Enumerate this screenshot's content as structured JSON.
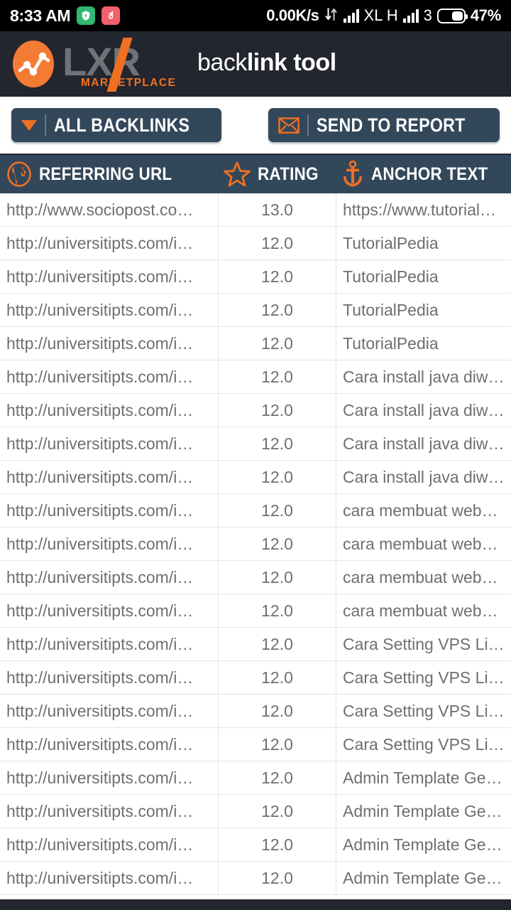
{
  "status_bar": {
    "clock": "8:33 AM",
    "app_icons": [
      {
        "name": "security-shield-icon",
        "color": "#2eb872"
      },
      {
        "name": "music-note-icon",
        "color": "#f4606c"
      }
    ],
    "network_speed": "0.00K/s",
    "data-transfer-icon": "up-down-arrows-icon",
    "network_type": "XL H",
    "sim_number": "3",
    "battery_percent": "47%"
  },
  "app_header": {
    "brand_letters": "LXR",
    "brand_sub": "MARKETPLACE",
    "product_thin": "back",
    "product_bold": "link tool",
    "logo_icon": "lxr-chart-logo-icon",
    "background": "#23262e"
  },
  "toolbar": {
    "filter_button": {
      "label": "ALL BACKLINKS",
      "icon": "chevron-down-icon"
    },
    "report_button": {
      "label": "SEND TO REPORT",
      "icon": "envelope-icon"
    },
    "accent_color": "#f07022",
    "button_color": "#33475a"
  },
  "table": {
    "columns": [
      {
        "label": "REFERRING URL",
        "icon": "globe-icon"
      },
      {
        "label": "RATING",
        "icon": "star-icon"
      },
      {
        "label": "ANCHOR TEXT",
        "icon": "anchor-icon"
      }
    ],
    "rows": [
      {
        "url": "http://www.sociopost.co…",
        "rating": "13.0",
        "anchor": "https://www.tutorial…"
      },
      {
        "url": "http://universitipts.com/i…",
        "rating": "12.0",
        "anchor": "TutorialPedia"
      },
      {
        "url": "http://universitipts.com/i…",
        "rating": "12.0",
        "anchor": "TutorialPedia"
      },
      {
        "url": "http://universitipts.com/i…",
        "rating": "12.0",
        "anchor": "TutorialPedia"
      },
      {
        "url": "http://universitipts.com/i…",
        "rating": "12.0",
        "anchor": "TutorialPedia"
      },
      {
        "url": "http://universitipts.com/i…",
        "rating": "12.0",
        "anchor": "Cara install java diw…"
      },
      {
        "url": "http://universitipts.com/i…",
        "rating": "12.0",
        "anchor": "Cara install java diw…"
      },
      {
        "url": "http://universitipts.com/i…",
        "rating": "12.0",
        "anchor": "Cara install java diw…"
      },
      {
        "url": "http://universitipts.com/i…",
        "rating": "12.0",
        "anchor": "Cara install java diw…"
      },
      {
        "url": "http://universitipts.com/i…",
        "rating": "12.0",
        "anchor": "cara membuat web…"
      },
      {
        "url": "http://universitipts.com/i…",
        "rating": "12.0",
        "anchor": "cara membuat web…"
      },
      {
        "url": "http://universitipts.com/i…",
        "rating": "12.0",
        "anchor": "cara membuat web…"
      },
      {
        "url": "http://universitipts.com/i…",
        "rating": "12.0",
        "anchor": "cara membuat web…"
      },
      {
        "url": "http://universitipts.com/i…",
        "rating": "12.0",
        "anchor": "Cara Setting VPS Li…"
      },
      {
        "url": "http://universitipts.com/i…",
        "rating": "12.0",
        "anchor": "Cara Setting VPS Li…"
      },
      {
        "url": "http://universitipts.com/i…",
        "rating": "12.0",
        "anchor": "Cara Setting VPS Li…"
      },
      {
        "url": "http://universitipts.com/i…",
        "rating": "12.0",
        "anchor": "Cara Setting VPS Li…"
      },
      {
        "url": "http://universitipts.com/i…",
        "rating": "12.0",
        "anchor": "Admin Template Ge…"
      },
      {
        "url": "http://universitipts.com/i…",
        "rating": "12.0",
        "anchor": "Admin Template Ge…"
      },
      {
        "url": "http://universitipts.com/i…",
        "rating": "12.0",
        "anchor": "Admin Template Ge…"
      },
      {
        "url": "http://universitipts.com/i…",
        "rating": "12.0",
        "anchor": "Admin Template Ge…"
      }
    ]
  }
}
